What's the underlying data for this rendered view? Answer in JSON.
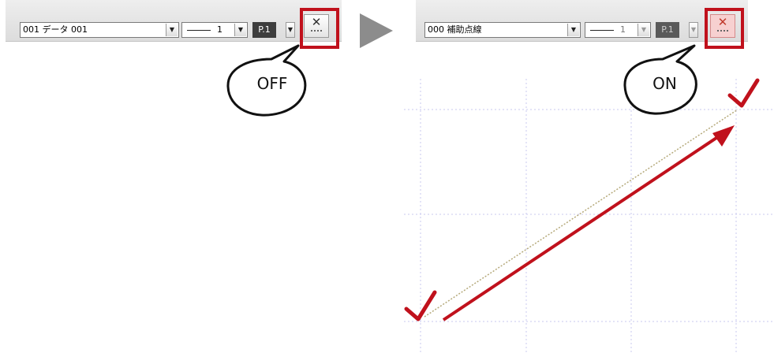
{
  "left_panel": {
    "layer_combo": "001 データ 001",
    "line_width": "1",
    "pen_label": "P.1",
    "callout": "OFF"
  },
  "right_panel": {
    "layer_combo": "000 補助点線",
    "line_width": "1",
    "pen_label": "P.1",
    "callout": "ON"
  },
  "icons": {
    "toggle": "close-x-dotted-icon",
    "dropdown": "chevron-down-icon",
    "transition": "triangle-arrow-right-icon",
    "checkmark": "checkmark-icon"
  },
  "colors": {
    "highlight": "#c0111c",
    "grid": "#c9c9ef",
    "toggle_on_bg": "#f7d0d0"
  }
}
